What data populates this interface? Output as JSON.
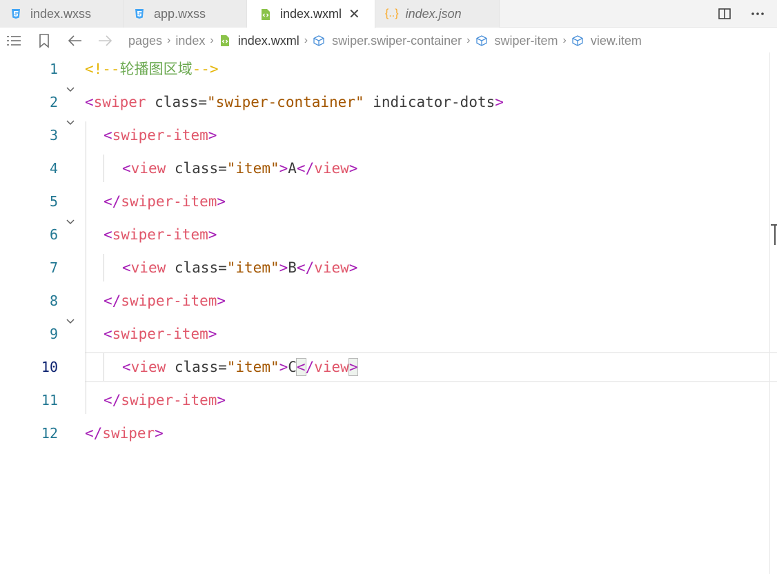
{
  "tabs": [
    {
      "label": "index.wxss",
      "icon": "css-icon",
      "active": false,
      "italic": false
    },
    {
      "label": "app.wxss",
      "icon": "css-icon",
      "active": false,
      "italic": false
    },
    {
      "label": "index.wxml",
      "icon": "wxml-file-icon",
      "active": true,
      "italic": false,
      "close": "✕"
    },
    {
      "label": "index.json",
      "icon": "json-icon",
      "active": false,
      "italic": true
    }
  ],
  "json_icon_text": "{..}",
  "breadcrumb": {
    "items": [
      "pages",
      "index",
      "index.wxml",
      "swiper.swiper-container",
      "swiper-item",
      "view.item"
    ]
  },
  "editor": {
    "current_line": 10,
    "lines": [
      {
        "num": "1",
        "tokens": [
          [
            "cm",
            "<!--"
          ],
          [
            "cmt",
            "轮播图区域"
          ],
          [
            "cm",
            "-->"
          ]
        ]
      },
      {
        "num": "2",
        "fold": true,
        "tokens": [
          [
            "pm",
            "<"
          ],
          [
            "tb",
            "swiper"
          ],
          [
            "at",
            " class="
          ],
          [
            "st",
            "\"swiper-container\""
          ],
          [
            "at",
            " indicator-dots"
          ],
          [
            "pm",
            ">"
          ]
        ]
      },
      {
        "num": "3",
        "fold": true,
        "indent": 1,
        "tokens": [
          [
            "pm",
            "<"
          ],
          [
            "tb",
            "swiper-item"
          ],
          [
            "pm",
            ">"
          ]
        ]
      },
      {
        "num": "4",
        "indent": 2,
        "tokens": [
          [
            "pm",
            "<"
          ],
          [
            "tb",
            "view"
          ],
          [
            "at",
            " class="
          ],
          [
            "st",
            "\"item\""
          ],
          [
            "pm",
            ">"
          ],
          [
            "at",
            "A"
          ],
          [
            "pm",
            "</"
          ],
          [
            "tb",
            "view"
          ],
          [
            "pm",
            ">"
          ]
        ]
      },
      {
        "num": "5",
        "indent": 1,
        "tokens": [
          [
            "pm",
            "</"
          ],
          [
            "tb",
            "swiper-item"
          ],
          [
            "pm",
            ">"
          ]
        ]
      },
      {
        "num": "6",
        "fold": true,
        "indent": 1,
        "tokens": [
          [
            "pm",
            "<"
          ],
          [
            "tb",
            "swiper-item"
          ],
          [
            "pm",
            ">"
          ]
        ]
      },
      {
        "num": "7",
        "indent": 2,
        "tokens": [
          [
            "pm",
            "<"
          ],
          [
            "tb",
            "view"
          ],
          [
            "at",
            " class="
          ],
          [
            "st",
            "\"item\""
          ],
          [
            "pm",
            ">"
          ],
          [
            "at",
            "B"
          ],
          [
            "pm",
            "</"
          ],
          [
            "tb",
            "view"
          ],
          [
            "pm",
            ">"
          ]
        ]
      },
      {
        "num": "8",
        "indent": 1,
        "tokens": [
          [
            "pm",
            "</"
          ],
          [
            "tb",
            "swiper-item"
          ],
          [
            "pm",
            ">"
          ]
        ]
      },
      {
        "num": "9",
        "fold": true,
        "indent": 1,
        "tokens": [
          [
            "pm",
            "<"
          ],
          [
            "tb",
            "swiper-item"
          ],
          [
            "pm",
            ">"
          ]
        ]
      },
      {
        "num": "10",
        "indent": 2,
        "tokens": [
          [
            "pm",
            "<"
          ],
          [
            "tb",
            "view"
          ],
          [
            "at",
            " class="
          ],
          [
            "st",
            "\"item\""
          ],
          [
            "pm",
            ">"
          ],
          [
            "at",
            "C"
          ],
          [
            "pm bm",
            "<"
          ],
          [
            "pm",
            "/"
          ],
          [
            "tb",
            "view"
          ],
          [
            "pm bm",
            ">"
          ]
        ]
      },
      {
        "num": "11",
        "indent": 1,
        "tokens": [
          [
            "pm",
            "</"
          ],
          [
            "tb",
            "swiper-item"
          ],
          [
            "pm",
            ">"
          ]
        ]
      },
      {
        "num": "12",
        "tokens": [
          [
            "pm",
            "</"
          ],
          [
            "tb",
            "swiper"
          ],
          [
            "pm",
            ">"
          ]
        ]
      }
    ]
  },
  "colors": {
    "css_icon": "#42a5f5",
    "wxml_icon": "#8bc34a",
    "json_icon": "#f9a825",
    "line_number": "#237893"
  }
}
